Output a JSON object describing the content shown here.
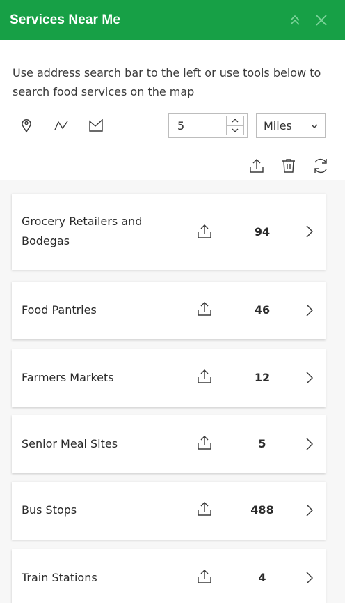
{
  "header": {
    "title": "Services Near Me",
    "accent_color": "#17a046",
    "collapse_icon": "double-chevron-up-icon",
    "close_icon": "close-icon"
  },
  "instructions": "Use address search bar to the left or use tools below to search food services on the map",
  "tools": {
    "point_icon": "map-pin-icon",
    "line_icon": "polyline-icon",
    "polygon_icon": "polygon-icon"
  },
  "distance": {
    "value": "5",
    "units_selected": "Miles"
  },
  "actions": {
    "export_icon": "export-icon",
    "delete_icon": "trash-icon",
    "refresh_icon": "refresh-icon"
  },
  "services": [
    {
      "label": "Grocery Retailers and Bodegas",
      "count": "94"
    },
    {
      "label": "Food Pantries",
      "count": "46"
    },
    {
      "label": "Farmers Markets",
      "count": "12"
    },
    {
      "label": "Senior Meal Sites",
      "count": "5"
    },
    {
      "label": "Bus Stops",
      "count": "488"
    },
    {
      "label": "Train Stations",
      "count": "4"
    }
  ]
}
